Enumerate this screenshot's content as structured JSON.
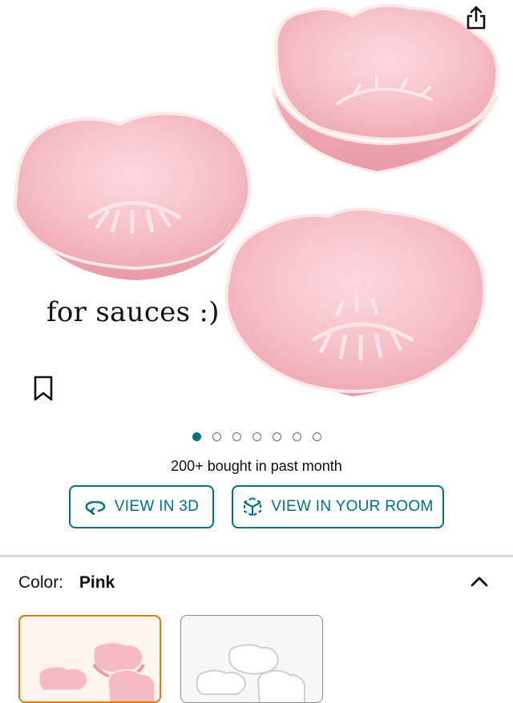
{
  "hero": {
    "caption": "for sauces :)",
    "slide_count": 7,
    "active_slide": 1
  },
  "social_proof": {
    "bought_text": "200+ bought in past month"
  },
  "actions": {
    "view_3d": "VIEW IN 3D",
    "view_room": "VIEW IN YOUR ROOM"
  },
  "color": {
    "label": "Color:",
    "selected": "Pink",
    "options": [
      {
        "name": "Pink",
        "selected": true
      },
      {
        "name": "White",
        "selected": false
      }
    ]
  },
  "colors": {
    "accent": "#007185",
    "selected_border": "#e47911",
    "bowl_pink": "#f4b9c1"
  },
  "icons": [
    "share-icon",
    "bookmark-icon",
    "rotate-3d-icon",
    "ar-cube-icon",
    "chevron-up-icon"
  ]
}
